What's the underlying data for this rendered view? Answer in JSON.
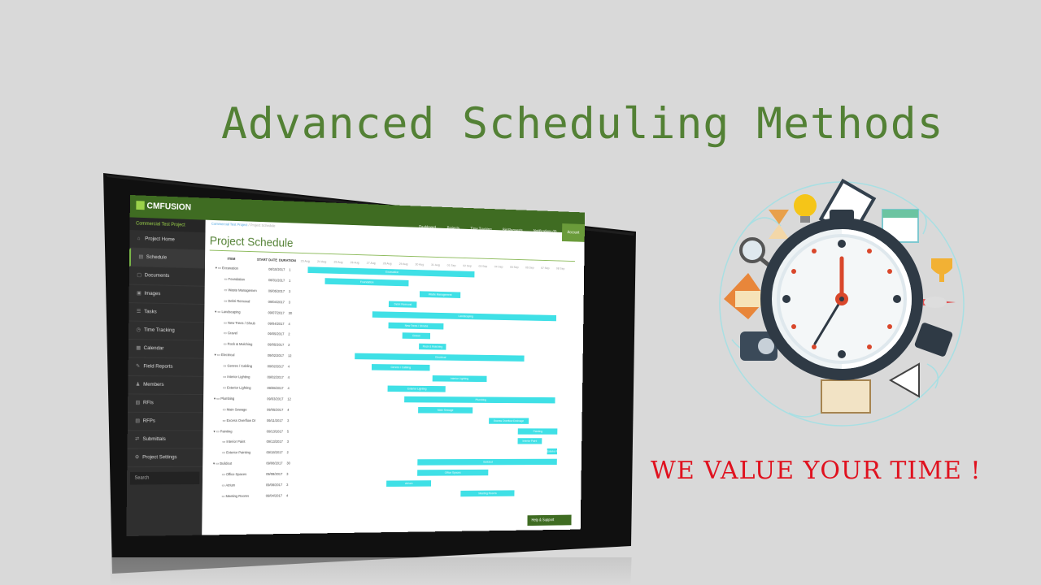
{
  "slide": {
    "title": "Advanced Scheduling Methods",
    "tagline": "WE VALUE YOUR TIME !"
  },
  "app": {
    "logo": "CMFUSION",
    "project_name": "Commercial Test Project",
    "breadcrumb": [
      "Commercial Test Project",
      "Project Schedule"
    ],
    "topnav": [
      "Dashboard",
      "Projects",
      "Time Tracking",
      "Bid Requests",
      "Notifications",
      "Account"
    ],
    "notification_count": "0",
    "sidebar": [
      "Project Home",
      "Schedule",
      "Documents",
      "Images",
      "Tasks",
      "Time Tracking",
      "Calendar",
      "Field Reports",
      "Members",
      "RFIs",
      "RFPs",
      "Submittals",
      "Project Settings"
    ],
    "sidebar_active": "Schedule",
    "search_placeholder": "Search",
    "page_title": "Project Schedule",
    "columns": [
      "ITEM",
      "START DATE",
      "DURATION"
    ],
    "tasks": [
      {
        "name": "Excavation",
        "date": "08/10/2017",
        "dur": "1",
        "group": true
      },
      {
        "name": "Foundation",
        "date": "08/31/2017",
        "dur": "1",
        "group": false
      },
      {
        "name": "Waste Managemen",
        "date": "09/05/2017",
        "dur": "3",
        "group": false
      },
      {
        "name": "Debri Removal",
        "date": "09/04/2017",
        "dur": "3",
        "group": false
      },
      {
        "name": "Landscaping",
        "date": "09/07/2017",
        "dur": "30",
        "group": true
      },
      {
        "name": "New Trees / Shrub",
        "date": "09/04/2017",
        "dur": "4",
        "group": false
      },
      {
        "name": "Gravel",
        "date": "09/05/2017",
        "dur": "2",
        "group": false
      },
      {
        "name": "Rock & Mulching",
        "date": "09/05/2017",
        "dur": "2",
        "group": false
      },
      {
        "name": "Electrical",
        "date": "09/02/2017",
        "dur": "12",
        "group": true
      },
      {
        "name": "Genres / Cabling",
        "date": "09/02/2017",
        "dur": "4",
        "group": false
      },
      {
        "name": "Interior Lighting",
        "date": "09/02/2017",
        "dur": "4",
        "group": false
      },
      {
        "name": "Exterior Lighting",
        "date": "09/08/2017",
        "dur": "4",
        "group": false
      },
      {
        "name": "Plumbing",
        "date": "09/03/2017",
        "dur": "12",
        "group": true
      },
      {
        "name": "Main Sewage",
        "date": "09/05/2017",
        "dur": "4",
        "group": false
      },
      {
        "name": "Excess Overflow Dr",
        "date": "09/11/2017",
        "dur": "3",
        "group": false
      },
      {
        "name": "Painting",
        "date": "09/13/2017",
        "dur": "5",
        "group": true
      },
      {
        "name": "Interior Paint",
        "date": "09/13/2017",
        "dur": "3",
        "group": false
      },
      {
        "name": "Exterior Painting",
        "date": "09/18/2017",
        "dur": "2",
        "group": false
      },
      {
        "name": "Buildout",
        "date": "09/08/2017",
        "dur": "30",
        "group": true
      },
      {
        "name": "Office Spaces",
        "date": "09/08/2017",
        "dur": "3",
        "group": false
      },
      {
        "name": "Atrium",
        "date": "09/08/2017",
        "dur": "3",
        "group": false
      },
      {
        "name": "Meeting Rooms",
        "date": "09/04/2017",
        "dur": "4",
        "group": false
      }
    ],
    "timeline_labels": [
      "23 Aug",
      "24 Aug",
      "25 Aug",
      "26 Aug",
      "27 Aug",
      "28 Aug",
      "29 Aug",
      "30 Aug",
      "31 Aug",
      "01 Sep",
      "02 Sep",
      "03 Sep",
      "04 Sep",
      "05 Sep",
      "06 Sep",
      "07 Sep",
      "08 Sep"
    ],
    "bars": [
      {
        "label": "Excavation",
        "start": 0.02,
        "len": 0.6
      },
      {
        "label": "Foundation",
        "start": 0.08,
        "len": 0.3
      },
      {
        "label": "Waste Management",
        "start": 0.42,
        "len": 0.15
      },
      {
        "label": "Debri Removal",
        "start": 0.31,
        "len": 0.1
      },
      {
        "label": "Landscaping",
        "start": 0.25,
        "len": 0.68
      },
      {
        "label": "New Trees / Shrubs",
        "start": 0.31,
        "len": 0.2
      },
      {
        "label": "Gravel",
        "start": 0.36,
        "len": 0.1
      },
      {
        "label": "Rock & Mulching",
        "start": 0.42,
        "len": 0.1
      },
      {
        "label": "Electrical",
        "start": 0.19,
        "len": 0.62
      },
      {
        "label": "Genres / Cabling",
        "start": 0.25,
        "len": 0.21
      },
      {
        "label": "Interior Lighting",
        "start": 0.47,
        "len": 0.2
      },
      {
        "label": "Exterior Lighting",
        "start": 0.31,
        "len": 0.21
      },
      {
        "label": "Plumbing",
        "start": 0.37,
        "len": 0.56
      },
      {
        "label": "Main Sewage",
        "start": 0.42,
        "len": 0.2
      },
      {
        "label": "Excess Overflow Drainage",
        "start": 0.68,
        "len": 0.15
      },
      {
        "label": "Painting",
        "start": 0.79,
        "len": 0.15
      },
      {
        "label": "Interior Paint",
        "start": 0.79,
        "len": 0.09
      },
      {
        "label": "Exterior Painting",
        "start": 0.9,
        "len": 0.04
      },
      {
        "label": "Buildout",
        "start": 0.42,
        "len": 0.52
      },
      {
        "label": "Office Spaces",
        "start": 0.42,
        "len": 0.26
      },
      {
        "label": "Atrium",
        "start": 0.31,
        "len": 0.16
      },
      {
        "label": "Meeting Rooms",
        "start": 0.58,
        "len": 0.2
      }
    ],
    "help_label": "Help & Support"
  },
  "colors": {
    "title": "#538135",
    "tagline": "#e0121f",
    "bar": "#3fe0e6",
    "brand": "#3f6c22"
  },
  "icons": [
    "clock-icon",
    "lightbulb-icon",
    "hourglass-icon",
    "magnifier-icon",
    "clipboard-icon",
    "calendar-icon",
    "trophy-icon",
    "rocket-icon",
    "envelope-icon",
    "telephone-icon",
    "briefcase-icon",
    "megaphone-icon",
    "book-icon"
  ]
}
